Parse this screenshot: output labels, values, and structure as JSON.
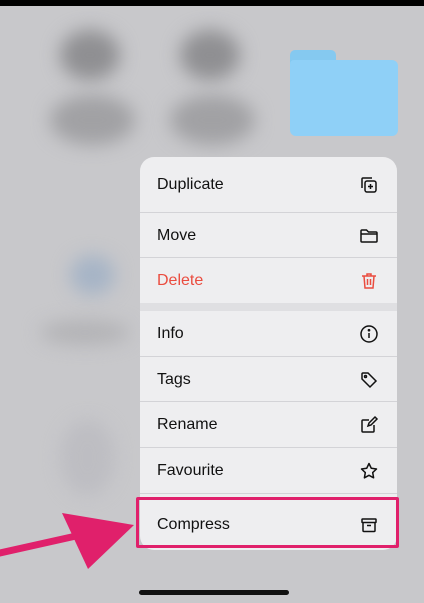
{
  "menu": {
    "items": [
      {
        "label": "Duplicate",
        "icon": "duplicate-icon"
      },
      {
        "label": "Move",
        "icon": "folder-icon"
      },
      {
        "label": "Delete",
        "icon": "trash-icon",
        "color": "#ea4c3f"
      },
      {
        "label": "Info",
        "icon": "info-icon"
      },
      {
        "label": "Tags",
        "icon": "tag-icon"
      },
      {
        "label": "Rename",
        "icon": "rename-icon"
      },
      {
        "label": "Favourite",
        "icon": "star-icon"
      },
      {
        "label": "Compress",
        "icon": "archive-icon"
      }
    ]
  },
  "colors": {
    "highlight": "#e0206b",
    "destructive": "#ea4c3f",
    "folder": "#8fd0f7"
  }
}
